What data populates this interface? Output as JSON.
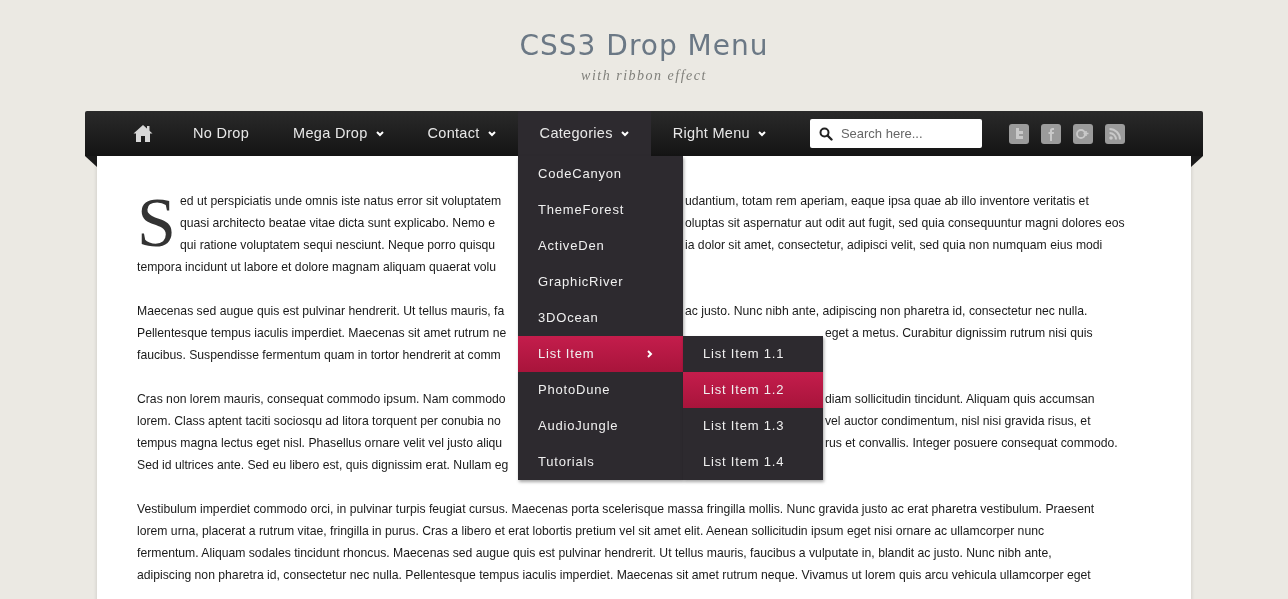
{
  "header": {
    "title": "CSS3 Drop Menu",
    "subtitle": "with ribbon effect"
  },
  "nav": {
    "items": [
      {
        "kind": "home",
        "selected": false
      },
      {
        "kind": "link",
        "label": "No Drop",
        "caret": false,
        "selected": false
      },
      {
        "kind": "link",
        "label": "Mega Drop",
        "caret": true,
        "selected": false
      },
      {
        "kind": "link",
        "label": "Contact",
        "caret": true,
        "selected": false
      },
      {
        "kind": "link",
        "label": "Categories",
        "caret": true,
        "selected": true
      },
      {
        "kind": "link",
        "label": "Right Menu",
        "caret": true,
        "selected": false
      }
    ],
    "search": {
      "placeholder": "Search here..."
    }
  },
  "dropdown": {
    "items": [
      {
        "label": "CodeCanyon",
        "selected": false
      },
      {
        "label": "ThemeForest",
        "selected": false
      },
      {
        "label": "ActiveDen",
        "selected": false
      },
      {
        "label": "GraphicRiver",
        "selected": false
      },
      {
        "label": "3DOcean",
        "selected": false
      },
      {
        "label": "List Item",
        "selected": true,
        "submenu": [
          {
            "label": "List Item 1.1",
            "selected": false
          },
          {
            "label": "List Item 1.2",
            "selected": true
          },
          {
            "label": "List Item 1.3",
            "selected": false
          },
          {
            "label": "List Item 1.4",
            "selected": false
          }
        ]
      },
      {
        "label": "PhotoDune",
        "selected": false
      },
      {
        "label": "AudioJungle",
        "selected": false
      },
      {
        "label": "Tutorials",
        "selected": false
      }
    ]
  },
  "article": {
    "drop_cap": "S",
    "paragraphs": [
      {
        "lines": [
          {
            "left": "ed ut perspiciatis unde omnis iste natus error sit voluptatem",
            "right": "udantium, totam rem aperiam, eaque ipsa quae ab illo inventore veritatis et"
          },
          {
            "left": "quasi architecto beatae vitae dicta sunt explicabo. Nemo e",
            "right": "oluptas sit aspernatur aut odit aut fugit, sed quia consequuntur magni dolores eos"
          },
          {
            "left": "qui ratione voluptatem sequi nesciunt. Neque porro quisqu",
            "right": "ia dolor sit amet, consectetur, adipisci velit, sed quia non numquam eius modi"
          },
          {
            "left": "tempora incidunt ut labore et dolore magnam aliquam quaerat volu"
          }
        ]
      },
      {
        "lines": [
          {
            "left": "Maecenas sed augue quis est pulvinar hendrerit. Ut tellus mauris, fa",
            "right": "ac justo. Nunc nibh ante, adipiscing non pharetra id, consectetur nec nulla."
          },
          {
            "left": "Pellentesque tempus iaculis imperdiet. Maecenas sit amet rutrum ne",
            "right": "eget a metus. Curabitur dignissim rutrum nisi quis"
          },
          {
            "left": "faucibus. Suspendisse fermentum quam in tortor hendrerit at comm"
          }
        ]
      },
      {
        "lines": [
          {
            "left": "Cras non lorem mauris, consequat commodo ipsum. Nam commodo",
            "right": "diam sollicitudin tincidunt. Aliquam quis accumsan"
          },
          {
            "left": "lorem. Class aptent taciti sociosqu ad litora torquent per conubia no",
            "right": "vel auctor condimentum, nisl nisi gravida risus, et"
          },
          {
            "left": "tempus magna lectus eget nisl. Phasellus ornare velit vel justo aliqu",
            "right": "rus et convallis. Integer posuere consequat commodo."
          },
          {
            "left": "Sed id ultrices ante. Sed eu libero est, quis dignissim erat. Nullam eg"
          }
        ]
      },
      {
        "lines": [
          {
            "left": "Vestibulum imperdiet commodo orci, in pulvinar turpis feugiat cursus. Maecenas porta scelerisque massa fringilla mollis. Nunc gravida justo ac erat pharetra vestibulum. Praesent"
          },
          {
            "left": "lorem urna, placerat a rutrum vitae, fringilla in purus. Cras a libero et erat lobortis pretium vel sit amet elit. Aenean sollicitudin ipsum eget nisi ornare ac ullamcorper nunc"
          },
          {
            "left": "fermentum. Aliquam sodales tincidunt rhoncus. Maecenas sed augue quis est pulvinar hendrerit. Ut tellus mauris, faucibus a vulputate in, blandit ac justo. Nunc nibh ante,"
          },
          {
            "left": "adipiscing non pharetra id, consectetur nec nulla. Pellentesque tempus iaculis imperdiet. Maecenas sit amet rutrum neque. Vivamus ut lorem quis arcu vehicula ullamcorper eget"
          }
        ]
      }
    ]
  }
}
